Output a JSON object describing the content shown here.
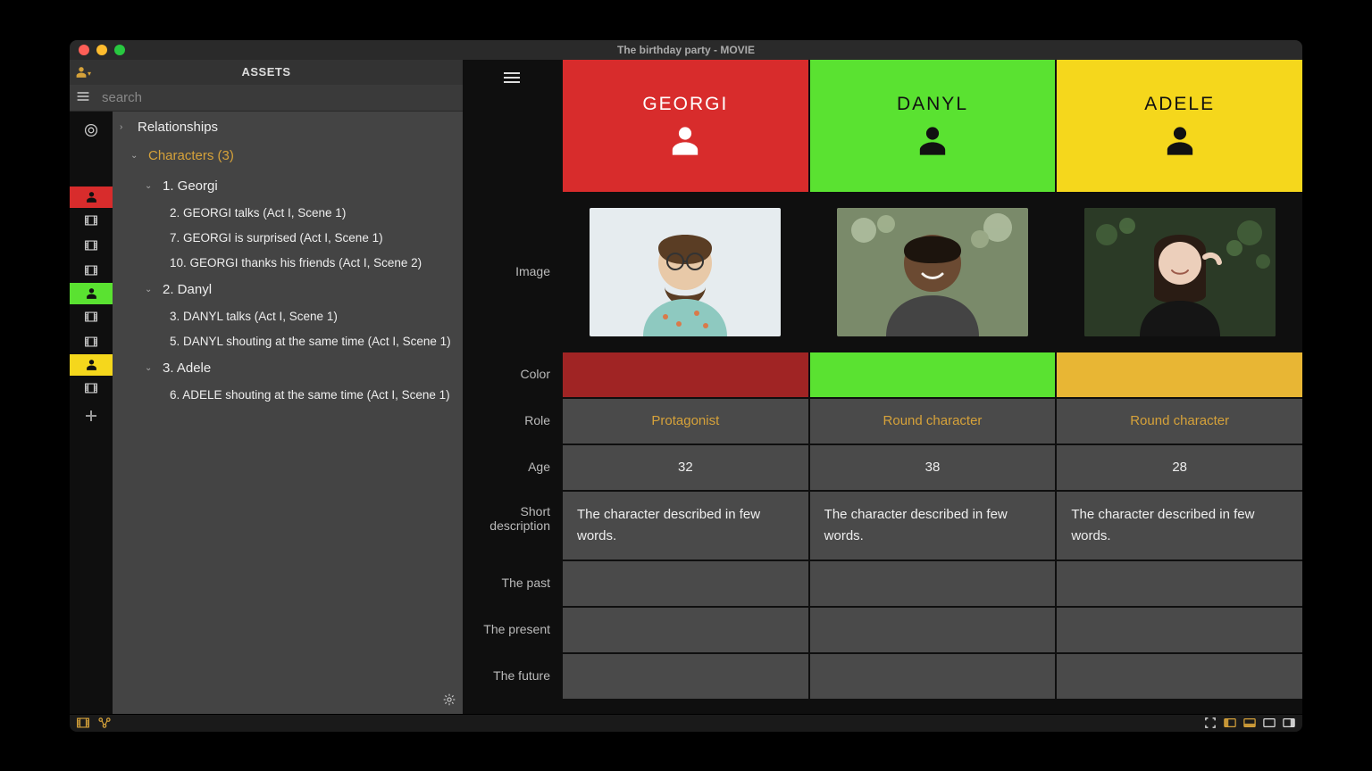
{
  "window": {
    "title": "The birthday party - MOVIE"
  },
  "sidebar": {
    "header": "ASSETS",
    "search_placeholder": "search",
    "tree": {
      "relationships": "Relationships",
      "characters_label": "Characters (3)",
      "char1": {
        "name": "1. Georgi",
        "scenes": [
          "2. GEORGI talks (Act I, Scene 1)",
          "7. GEORGI is surprised (Act I, Scene 1)",
          "10. GEORGI thanks his friends (Act I, Scene 2)"
        ]
      },
      "char2": {
        "name": "2. Danyl",
        "scenes": [
          "3. DANYL talks (Act I, Scene 1)",
          "5. DANYL shouting at the same time (Act I, Scene 1)"
        ]
      },
      "char3": {
        "name": "3. Adele",
        "scenes": [
          "6. ADELE shouting at the same time (Act I, Scene 1)"
        ]
      }
    }
  },
  "detail": {
    "headers": {
      "georgi": "GEORGI",
      "danyl": "DANYL",
      "adele": "ADELE"
    },
    "labels": {
      "image": "Image",
      "color": "Color",
      "role": "Role",
      "age": "Age",
      "short_desc": "Short description",
      "past": "The past",
      "present": "The present",
      "future": "The future"
    },
    "georgi": {
      "color": "#a02424",
      "role": "Protagonist",
      "age": "32",
      "short_desc": "The character described in few words."
    },
    "danyl": {
      "color": "#5ae231",
      "role": "Round character",
      "age": "38",
      "short_desc": "The character described in few words."
    },
    "adele": {
      "color": "#e8b634",
      "role": "Round character",
      "age": "28",
      "short_desc": "The character described in few words."
    }
  }
}
